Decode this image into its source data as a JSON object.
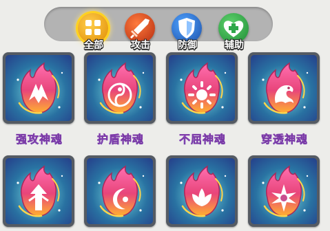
{
  "filter_tabs": [
    {
      "label": "全部",
      "icon": "grid-icon",
      "color": "#f2a100",
      "selected": true
    },
    {
      "label": "攻击",
      "icon": "sword-icon",
      "color": "#d94a1e",
      "selected": false
    },
    {
      "label": "防御",
      "icon": "shield-icon",
      "color": "#2a6fc9",
      "selected": false
    },
    {
      "label": "辅助",
      "icon": "heart-plus-icon",
      "color": "#2fa84a",
      "selected": false
    }
  ],
  "souls_row1": [
    {
      "name": "强攻神魂",
      "emblem": "fang-icon"
    },
    {
      "name": "护盾神魂",
      "emblem": "yin-yang-icon"
    },
    {
      "name": "不屈神魂",
      "emblem": "sun-icon"
    },
    {
      "name": "穿透神魂",
      "emblem": "dragon-icon"
    }
  ],
  "souls_row2": [
    {
      "emblem": "arrow-tree-icon"
    },
    {
      "emblem": "crescent-moon-icon"
    },
    {
      "emblem": "lotus-icon"
    },
    {
      "emblem": "star-burst-icon"
    }
  ],
  "colors": {
    "background": "#ededea",
    "card_frame": "#555b63",
    "card_bg_inner": "#3fb7c7",
    "card_bg_outer": "#253f8a",
    "flame_top": "#ff6fb0",
    "flame_bottom": "#ffb030",
    "name_gradient_top": "#f3a0ff",
    "name_gradient_bottom": "#6fc8ff"
  }
}
